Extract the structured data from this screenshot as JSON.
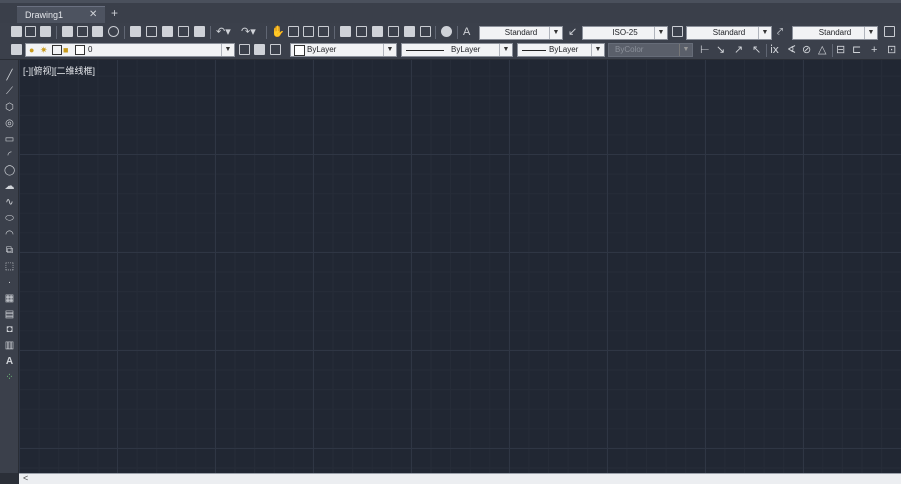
{
  "tab": {
    "title": "Drawing1",
    "close": "✕",
    "new": "+"
  },
  "styles": {
    "text_style": "Standard",
    "dim_style": "ISO-25",
    "table_style": "Standard",
    "mleader_style": "Standard"
  },
  "layer": {
    "current": "0"
  },
  "properties": {
    "color": "ByLayer",
    "linetype": "ByLayer",
    "lineweight": "ByLayer",
    "plotstyle": "ByColor"
  },
  "viewport": {
    "label": "[-][俯视][二维线框]"
  },
  "left_tools": [
    "line-icon",
    "polyline-icon",
    "polygon-icon",
    "circle-icon",
    "rectangle-icon",
    "arc-icon",
    "circle2-icon",
    "revcloud-icon",
    "spline-icon",
    "ellipse-icon",
    "ellipse-arc-icon",
    "insert-block-icon",
    "make-block-icon",
    "point-icon",
    "hatch-icon",
    "gradient-icon",
    "region-icon",
    "table-icon",
    "mtext-icon",
    "add-selected-icon"
  ]
}
